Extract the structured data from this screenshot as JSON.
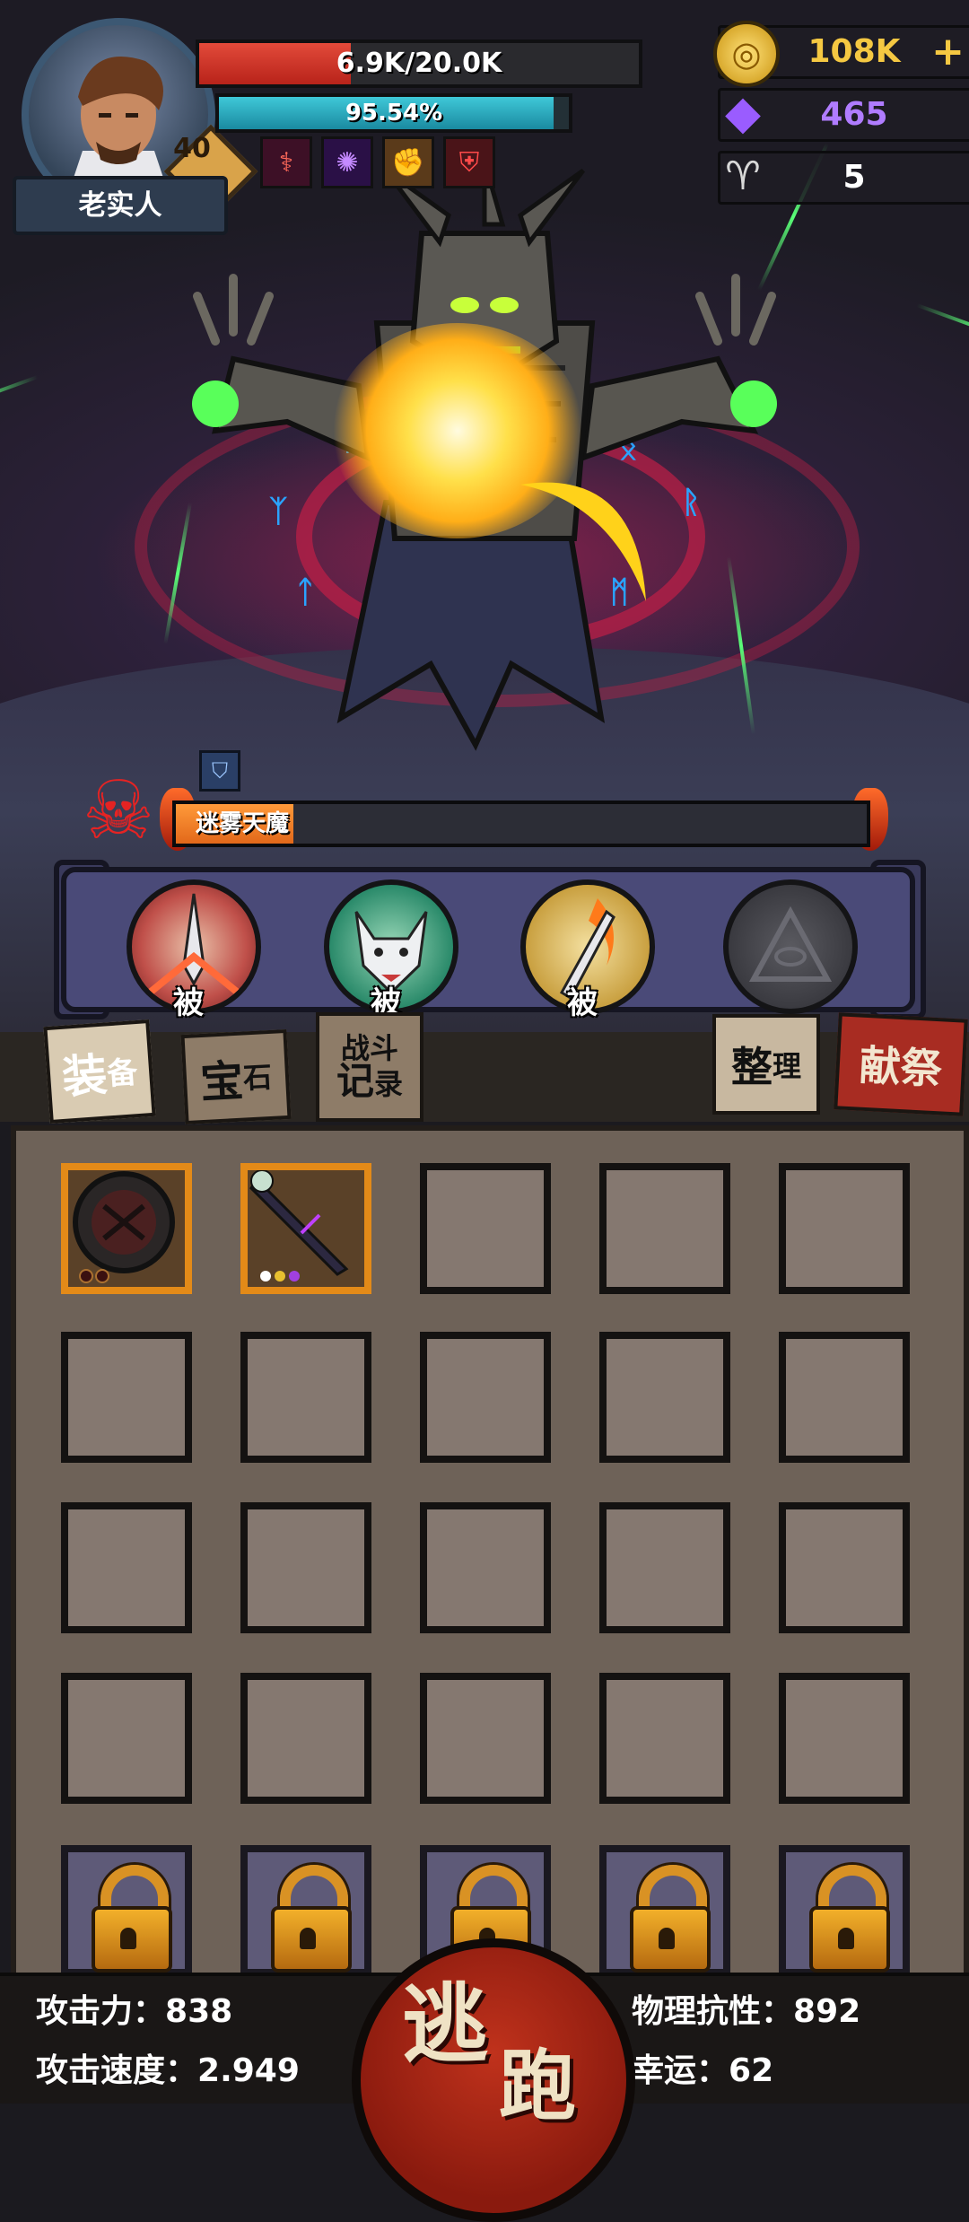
{
  "player": {
    "name": "老实人",
    "level": "40",
    "hp_text": "6.9K/20.0K",
    "hp_fraction": 0.345,
    "xp_text": "95.54%",
    "xp_fraction": 0.9554,
    "buffs": [
      {
        "icon": "staff-attack-up-icon",
        "glyph": "⚕"
      },
      {
        "icon": "vortex-icon",
        "glyph": "✺"
      },
      {
        "icon": "fist-icon",
        "glyph": "✊"
      },
      {
        "icon": "shield-defense-up-icon",
        "glyph": "⛨"
      }
    ]
  },
  "currency": {
    "gold": "108K",
    "crystal": "465",
    "ram_horn": "5",
    "colors": {
      "gold": "#f5c842",
      "crystal": "#b07cff",
      "horn": "#ffffff"
    }
  },
  "enemy": {
    "name": "迷雾天魔",
    "hp_fraction": 0.17,
    "debuff_icon": "shield-defense-down-icon"
  },
  "skills": [
    {
      "name": "blade-skill",
      "tag": "被",
      "icon": "blade-burst-icon"
    },
    {
      "name": "wolf-skill",
      "tag": "被",
      "icon": "wolf-head-icon"
    },
    {
      "name": "flame-blade-skill",
      "tag": "被",
      "icon": "flame-blade-icon"
    },
    {
      "name": "locked-skill",
      "tag": "",
      "icon": "eye-triangle-icon"
    }
  ],
  "tabs": {
    "equipment": {
      "big": "装",
      "small": "备"
    },
    "gems": {
      "big": "宝",
      "small": "石"
    },
    "battle_log_line1": "战斗",
    "battle_log_line2_big": "记",
    "battle_log_line2_small": "录",
    "sort": {
      "big": "整",
      "small": "理"
    },
    "sacrifice": "献祭"
  },
  "inventory": {
    "items": [
      {
        "name": "round-shield-item",
        "icon": "round-shield-icon"
      },
      {
        "name": "cursed-sword-item",
        "icon": "cursed-sword-icon"
      }
    ],
    "empty_slots": 18,
    "locked_slots": 5
  },
  "stats": {
    "attack_label": "攻击力：",
    "attack_value": "838",
    "attack_speed_label": "攻击速度：",
    "attack_speed_value": "2.949",
    "phys_resist_label": "物理抗性：",
    "phys_resist_value": "892",
    "luck_label": "幸运：",
    "luck_value": "62"
  },
  "flee_button": {
    "char1": "逃",
    "char2": "跑"
  }
}
